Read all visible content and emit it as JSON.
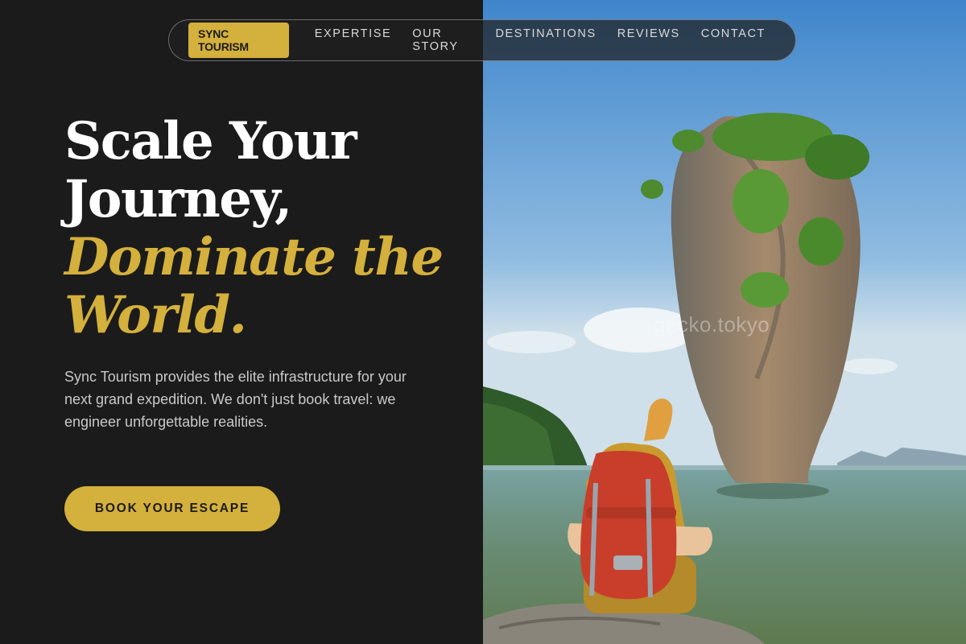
{
  "nav": {
    "brand": "SYNC TOURISM",
    "links": [
      "EXPERTISE",
      "OUR STORY",
      "DESTINATIONS",
      "REVIEWS",
      "CONTACT"
    ]
  },
  "hero": {
    "headline_line1": "Scale Your",
    "headline_line2": "Journey,",
    "headline_accent1": "Dominate the",
    "headline_accent2": "World.",
    "description": "Sync Tourism provides the elite infrastructure for your next grand expedition. We don't just book travel: we engineer unforgettable realities.",
    "cta_label": "BOOK YOUR ESCAPE"
  },
  "photo": {
    "watermark": "gecko.tokyo"
  },
  "colors": {
    "background": "#1b1b1b",
    "accent": "#d4b03c",
    "text_light": "#ffffff",
    "text_muted": "#c9c9c9"
  }
}
